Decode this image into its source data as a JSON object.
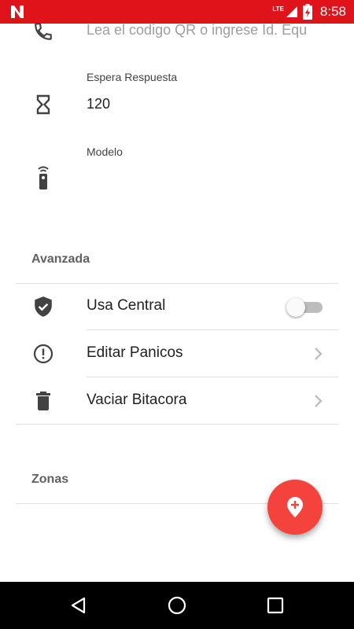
{
  "status_bar": {
    "time": "8:58",
    "network": "LTE",
    "icons": [
      "app-notification-icon",
      "signal-icon",
      "battery-charging-icon"
    ]
  },
  "fields": {
    "device_id": {
      "icon": "phone-icon",
      "placeholder": "Lea el codigo QR o ingrese Id. Equ"
    },
    "response_wait": {
      "icon": "hourglass-icon",
      "label": "Espera Respuesta",
      "value": "120"
    },
    "model": {
      "icon": "remote-control-icon",
      "label": "Modelo",
      "value": ""
    }
  },
  "sections": {
    "advanced": {
      "title": "Avanzada",
      "items": [
        {
          "icon": "verified-shield-icon",
          "label": "Usa Central",
          "type": "toggle",
          "checked": false
        },
        {
          "icon": "alert-circle-icon",
          "label": "Editar Panicos",
          "type": "link"
        },
        {
          "icon": "trash-icon",
          "label": "Vaciar Bitacora",
          "type": "link"
        }
      ]
    },
    "zones": {
      "title": "Zonas"
    }
  },
  "fab": {
    "icon": "add-location-icon",
    "color": "#f4433c"
  },
  "nav_bar": {
    "buttons": [
      "back-icon",
      "home-icon",
      "recents-icon"
    ]
  },
  "colors": {
    "status_bar": "#e0121a",
    "accent": "#f4433c",
    "icon": "#424242"
  }
}
